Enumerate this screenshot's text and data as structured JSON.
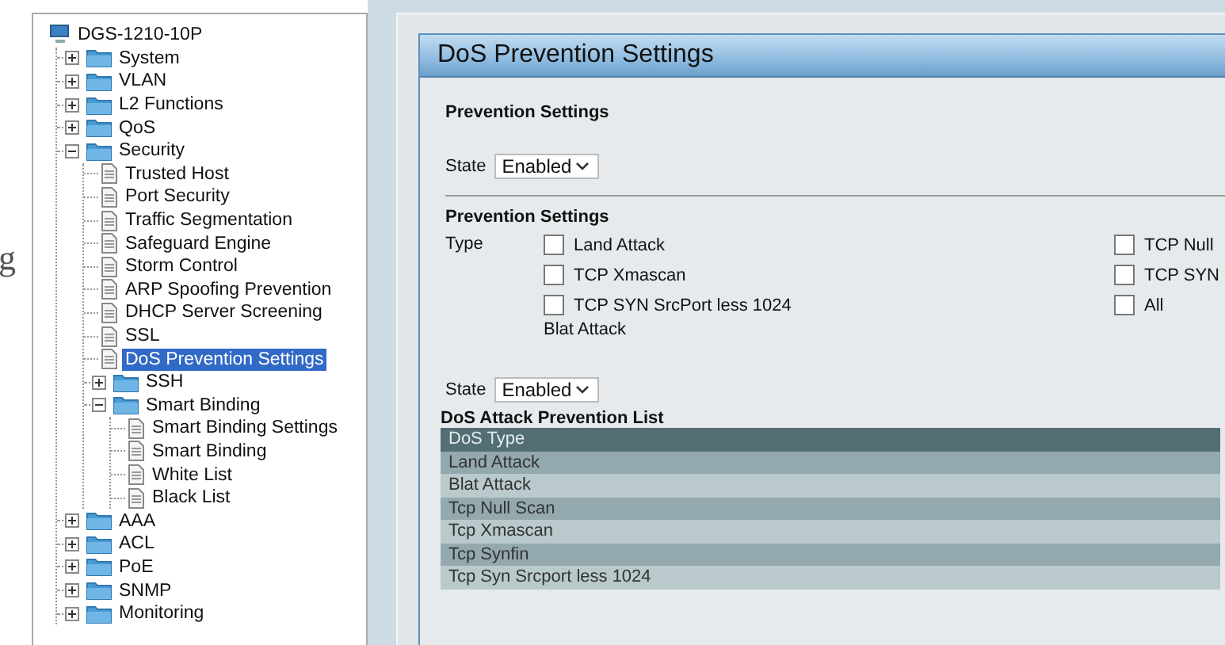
{
  "edge_text": "g",
  "tree": {
    "label": "DGS-1210-10P",
    "kind": "device",
    "children": [
      {
        "label": "System",
        "kind": "folder",
        "expanded": false,
        "selected": false
      },
      {
        "label": "VLAN",
        "kind": "folder",
        "expanded": false,
        "selected": false
      },
      {
        "label": "L2 Functions",
        "kind": "folder",
        "expanded": false,
        "selected": false
      },
      {
        "label": "QoS",
        "kind": "folder",
        "expanded": false,
        "selected": false
      },
      {
        "label": "Security",
        "kind": "folder",
        "expanded": true,
        "selected": false,
        "children": [
          {
            "label": "Trusted Host",
            "kind": "page",
            "selected": false
          },
          {
            "label": "Port Security",
            "kind": "page",
            "selected": false
          },
          {
            "label": "Traffic Segmentation",
            "kind": "page",
            "selected": false
          },
          {
            "label": "Safeguard Engine",
            "kind": "page",
            "selected": false
          },
          {
            "label": "Storm Control",
            "kind": "page",
            "selected": false
          },
          {
            "label": "ARP Spoofing Prevention",
            "kind": "page",
            "selected": false
          },
          {
            "label": "DHCP Server Screening",
            "kind": "page",
            "selected": false
          },
          {
            "label": "SSL",
            "kind": "page",
            "selected": false
          },
          {
            "label": "DoS Prevention Settings",
            "kind": "page",
            "selected": true
          },
          {
            "label": "SSH",
            "kind": "folder",
            "expanded": false,
            "selected": false
          },
          {
            "label": "Smart Binding",
            "kind": "folder",
            "expanded": true,
            "selected": false,
            "children": [
              {
                "label": "Smart Binding Settings",
                "kind": "page",
                "selected": false
              },
              {
                "label": "Smart Binding",
                "kind": "page",
                "selected": false
              },
              {
                "label": "White List",
                "kind": "page",
                "selected": false
              },
              {
                "label": "Black List",
                "kind": "page",
                "selected": false
              }
            ]
          }
        ]
      },
      {
        "label": "AAA",
        "kind": "folder",
        "expanded": false,
        "selected": false
      },
      {
        "label": "ACL",
        "kind": "folder",
        "expanded": false,
        "selected": false
      },
      {
        "label": "PoE",
        "kind": "folder",
        "expanded": false,
        "selected": false
      },
      {
        "label": "SNMP",
        "kind": "folder",
        "expanded": false,
        "selected": false
      },
      {
        "label": "Monitoring",
        "kind": "folder",
        "expanded": false,
        "selected": false
      }
    ]
  },
  "panel": {
    "title": "DoS Prevention Settings",
    "section_1": {
      "heading": "Prevention Settings",
      "state_label": "State",
      "state_value": "Enabled"
    },
    "section_2": {
      "heading": "Prevention Settings",
      "type_label": "Type",
      "options_left": [
        {
          "label": "Land Attack",
          "checked": false
        },
        {
          "label": "TCP Xmascan",
          "checked": false
        },
        {
          "label": "TCP SYN SrcPort less 1024",
          "checked": false
        }
      ],
      "options_right": [
        {
          "label": "TCP Null",
          "checked": false
        },
        {
          "label": "TCP SYN",
          "checked": false
        },
        {
          "label": "All",
          "checked": false
        }
      ],
      "note": "Blat Attack",
      "state_label": "State",
      "state_value": "Enabled"
    },
    "list": {
      "title": "DoS Attack Prevention List",
      "columns": [
        "DoS Type"
      ],
      "rows": [
        "Land Attack",
        "Blat Attack",
        "Tcp Null Scan",
        "Tcp Xmascan",
        "Tcp Synfin",
        "Tcp Syn Srcport less 1024"
      ]
    }
  }
}
